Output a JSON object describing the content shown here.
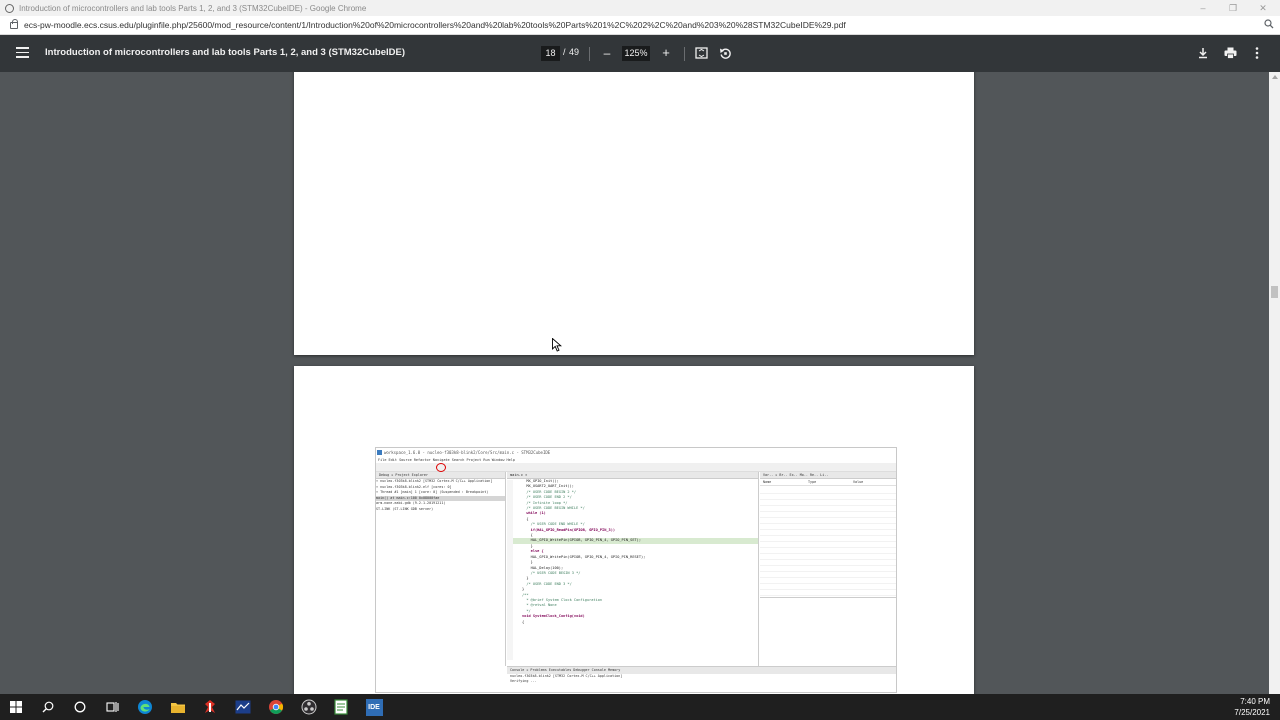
{
  "window": {
    "title": "Introduction of microcontrollers and lab tools Parts 1, 2, and 3 (STM32CubeIDE) - Google Chrome",
    "controls": [
      "–",
      "❐",
      "✕"
    ]
  },
  "address_bar": {
    "url": "ecs-pw-moodle.ecs.csus.edu/pluginfile.php/25600/mod_resource/content/1/Introduction%20of%20microcontrollers%20and%20lab%20tools%20Parts%201%2C%202%2C%20and%203%20%28STM32CubeIDE%29.pdf"
  },
  "pdf_toolbar": {
    "doc_title": "Introduction of microcontrollers and lab tools Parts 1, 2, and 3 (STM32CubeIDE)",
    "current_page": "18",
    "page_separator": "/",
    "total_pages": "49",
    "zoom_out": "–",
    "zoom": "125%",
    "zoom_in": "+"
  },
  "ide": {
    "title": "workspace_1.6.0 - nucleo-f303k8-blink2/Core/Src/main.c - STM32CubeIDE",
    "menu": "File  Edit  Source  Refactor  Navigate  Search  Project  Run  Window  Help",
    "left_tabs": "Debug  ✕  Project Explorer",
    "left_lines": [
      "▾ nucleo-f303k8-blink2 [STM32 Cortex-M C/C++ Application]",
      "   ▾ nucleo-f303k8-blink2.elf [cores: 0]",
      "      ▾ Thread #1 [main] 1 [core: 0] (Suspended : Breakpoint)",
      "           main() at main.c:100 0x08000fae",
      "   arm-none-eabi-gdb (9.2.1.20191211)",
      "   ST-LINK (ST-LINK GDB server)"
    ],
    "code_tab": "main.c ✕",
    "code_lines": [
      "  MX_GPIO_Init();",
      "  MX_USART2_UART_Init();",
      "  /* USER CODE BEGIN 2 */",
      "",
      "  /* USER CODE END 2 */",
      "",
      "  /* Infinite loop */",
      "  /* USER CODE BEGIN WHILE */",
      "  while (1)",
      "  {",
      "    /* USER CODE END WHILE */",
      "",
      "    if(HAL_GPIO_ReadPin(GPIOB, GPIO_PIN_3))",
      "    {",
      "    HAL_GPIO_WritePin(GPIOB, GPIO_PIN_4, GPIO_PIN_SET);",
      "    }",
      "    else {",
      "    HAL_GPIO_WritePin(GPIOB, GPIO_PIN_4, GPIO_PIN_RESET);",
      "    }",
      "    HAL_Delay(100);",
      "",
      "    /* USER CODE BEGIN 3 */",
      "",
      "  }",
      "  /* USER CODE END 3 */",
      "}",
      "",
      "/**",
      "  * @brief System Clock Configuration",
      "  * @retval None",
      "  */",
      "void SystemClock_Config(void)",
      "{"
    ],
    "right_tabs": "Var.. ✕  Br..  Ex..  Mo..  Re..  Li..",
    "right_cols": [
      "Name",
      "Type",
      "Value"
    ],
    "bottom_tabs": "Console ✕  Problems  Executables  Debugger Console  Memory",
    "bottom_lines": [
      "nucleo-f303k8-blink2 [STM32 Cortex-M C/C++ Application]",
      "Verifying ..."
    ]
  },
  "taskbar": {
    "time": "7:40 PM",
    "date": "7/25/2021",
    "apps": [
      "windows-start",
      "search",
      "cortana",
      "task-view",
      "edge",
      "file-explorer",
      "app-red",
      "app-blue",
      "chrome",
      "obs",
      "notepad-green",
      "stm32cubeide"
    ],
    "ide_badge": "IDE"
  }
}
